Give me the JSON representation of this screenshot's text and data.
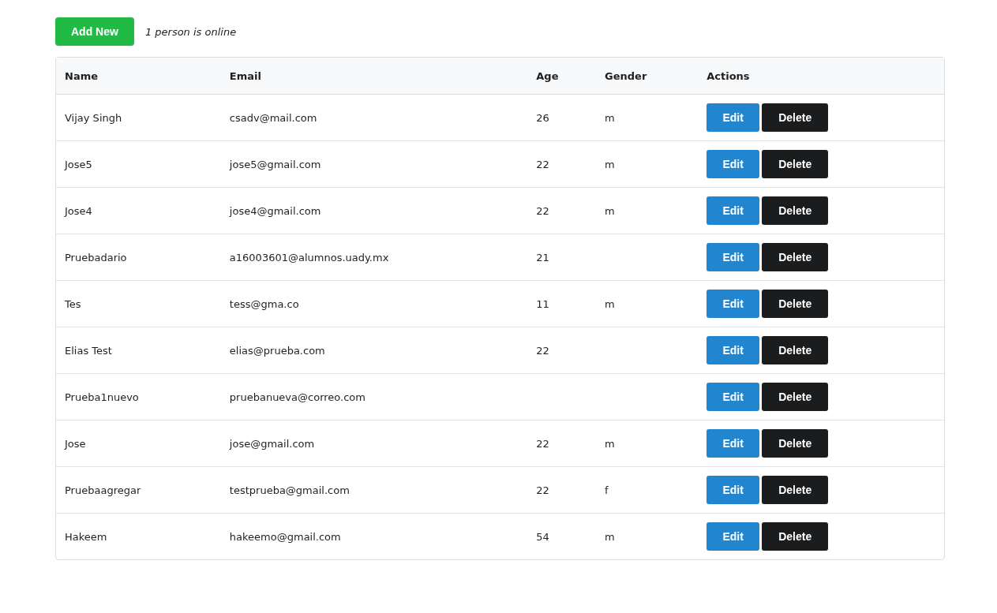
{
  "toolbar": {
    "add_button": "Add New",
    "online_status": "1 person is online"
  },
  "table": {
    "columns": [
      "Name",
      "Email",
      "Age",
      "Gender",
      "Actions"
    ],
    "rows": [
      {
        "name": "Vijay Singh",
        "email": "csadv@mail.com",
        "age": "26",
        "gender": "m",
        "actions": [
          "Edit",
          "Delete"
        ]
      },
      {
        "name": "Jose5",
        "email": "jose5@gmail.com",
        "age": "22",
        "gender": "m",
        "actions": [
          "Edit",
          "Delete"
        ]
      },
      {
        "name": "Jose4",
        "email": "jose4@gmail.com",
        "age": "22",
        "gender": "m",
        "actions": [
          "Edit",
          "Delete"
        ]
      },
      {
        "name": "Pruebadario",
        "email": "a16003601@alumnos.uady.mx",
        "age": "21",
        "actions": [
          "Edit",
          "Delete"
        ]
      },
      {
        "name": "Tes",
        "email": "tess@gma.co",
        "age": "11",
        "gender": "m",
        "actions": [
          "Edit",
          "Delete"
        ]
      },
      {
        "name": "Elias Test",
        "email": "elias@prueba.com",
        "age": "22",
        "actions": [
          "Edit",
          "Delete"
        ]
      },
      {
        "name": "Prueba1nuevo",
        "email": "pruebanueva@correo.com",
        "actions": [
          "Edit",
          "Delete"
        ]
      },
      {
        "name": "Jose",
        "email": "jose@gmail.com",
        "age": "22",
        "gender": "m",
        "actions": [
          "Edit",
          "Delete"
        ]
      },
      {
        "name": "Pruebaagregar",
        "email": "testprueba@gmail.com",
        "age": "22",
        "gender": "f",
        "actions": [
          "Edit",
          "Delete"
        ]
      },
      {
        "name": "Hakeem",
        "email": "hakeemo@gmail.com",
        "age": "54",
        "gender": "m",
        "actions": [
          "Edit",
          "Delete"
        ]
      }
    ]
  }
}
